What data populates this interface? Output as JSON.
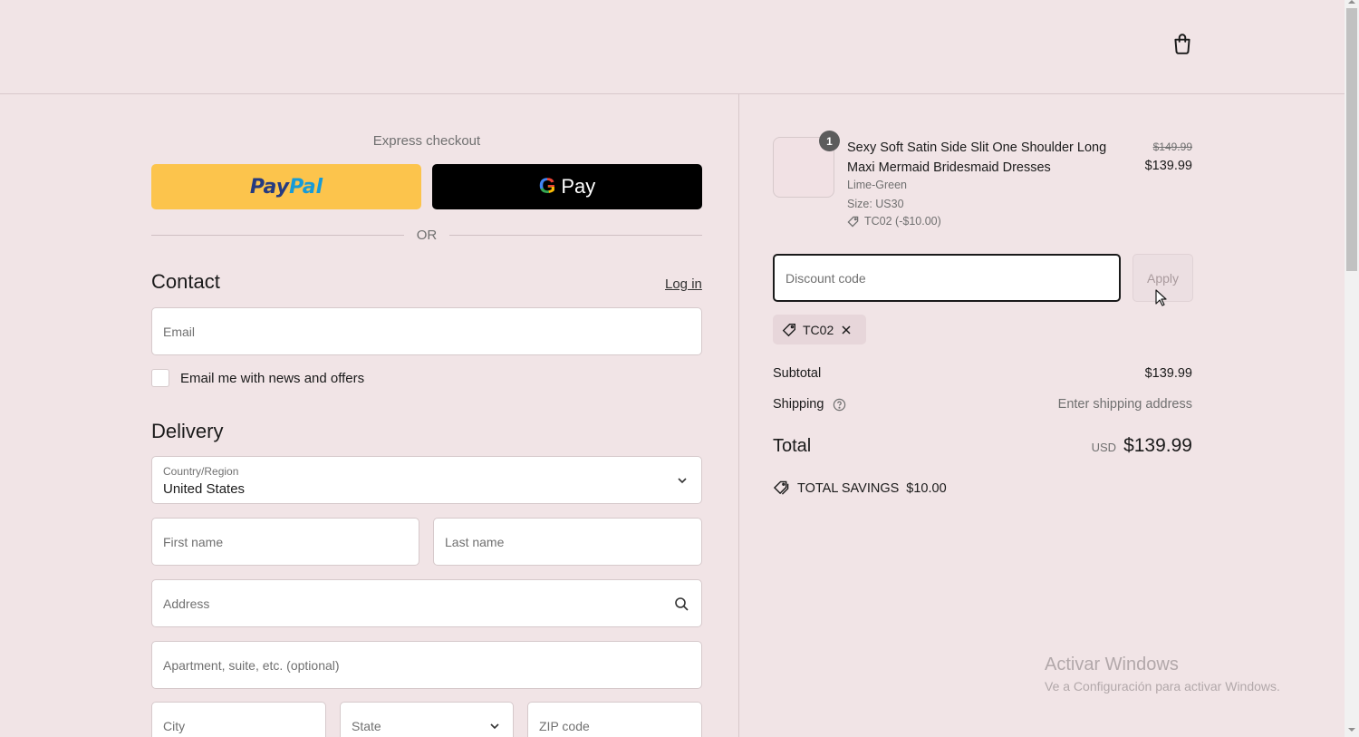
{
  "express": {
    "title": "Express checkout",
    "paypal_pay": "Pay",
    "paypal_pal": "Pal",
    "gpay_label": "Pay",
    "or_text": "OR"
  },
  "contact": {
    "title": "Contact",
    "login_link": "Log in",
    "email_placeholder": "Email",
    "newsletter_label": "Email me with news and offers"
  },
  "delivery": {
    "title": "Delivery",
    "country_label": "Country/Region",
    "country_value": "United States",
    "first_name_placeholder": "First name",
    "last_name_placeholder": "Last name",
    "address_placeholder": "Address",
    "apartment_placeholder": "Apartment, suite, etc. (optional)",
    "city_placeholder": "City",
    "state_placeholder": "State",
    "zip_placeholder": "ZIP code"
  },
  "order": {
    "quantity": "1",
    "product_name": "Sexy Soft Satin Side Slit One Shoulder Long Maxi Mermaid Bridesmaid Dresses",
    "color": "Lime-Green",
    "size": "Size: US30",
    "discount_line": "TC02 (-$10.00)",
    "price_original": "$149.99",
    "price_current": "$139.99"
  },
  "discount": {
    "placeholder": "Discount code",
    "apply_label": "Apply",
    "applied_code": "TC02"
  },
  "summary": {
    "subtotal_label": "Subtotal",
    "subtotal_value": "$139.99",
    "shipping_label": "Shipping",
    "shipping_value": "Enter shipping address",
    "total_label": "Total",
    "currency": "USD",
    "total_value": "$139.99",
    "savings_label": "TOTAL SAVINGS",
    "savings_value": "$10.00"
  },
  "watermark": {
    "title": "Activar Windows",
    "subtitle": "Ve a Configuración para activar Windows."
  },
  "colors": {
    "background": "#f1e4e6",
    "paypal": "#fcc44c",
    "gpay": "#000000",
    "field_border_focus": "#1a1a1a"
  }
}
